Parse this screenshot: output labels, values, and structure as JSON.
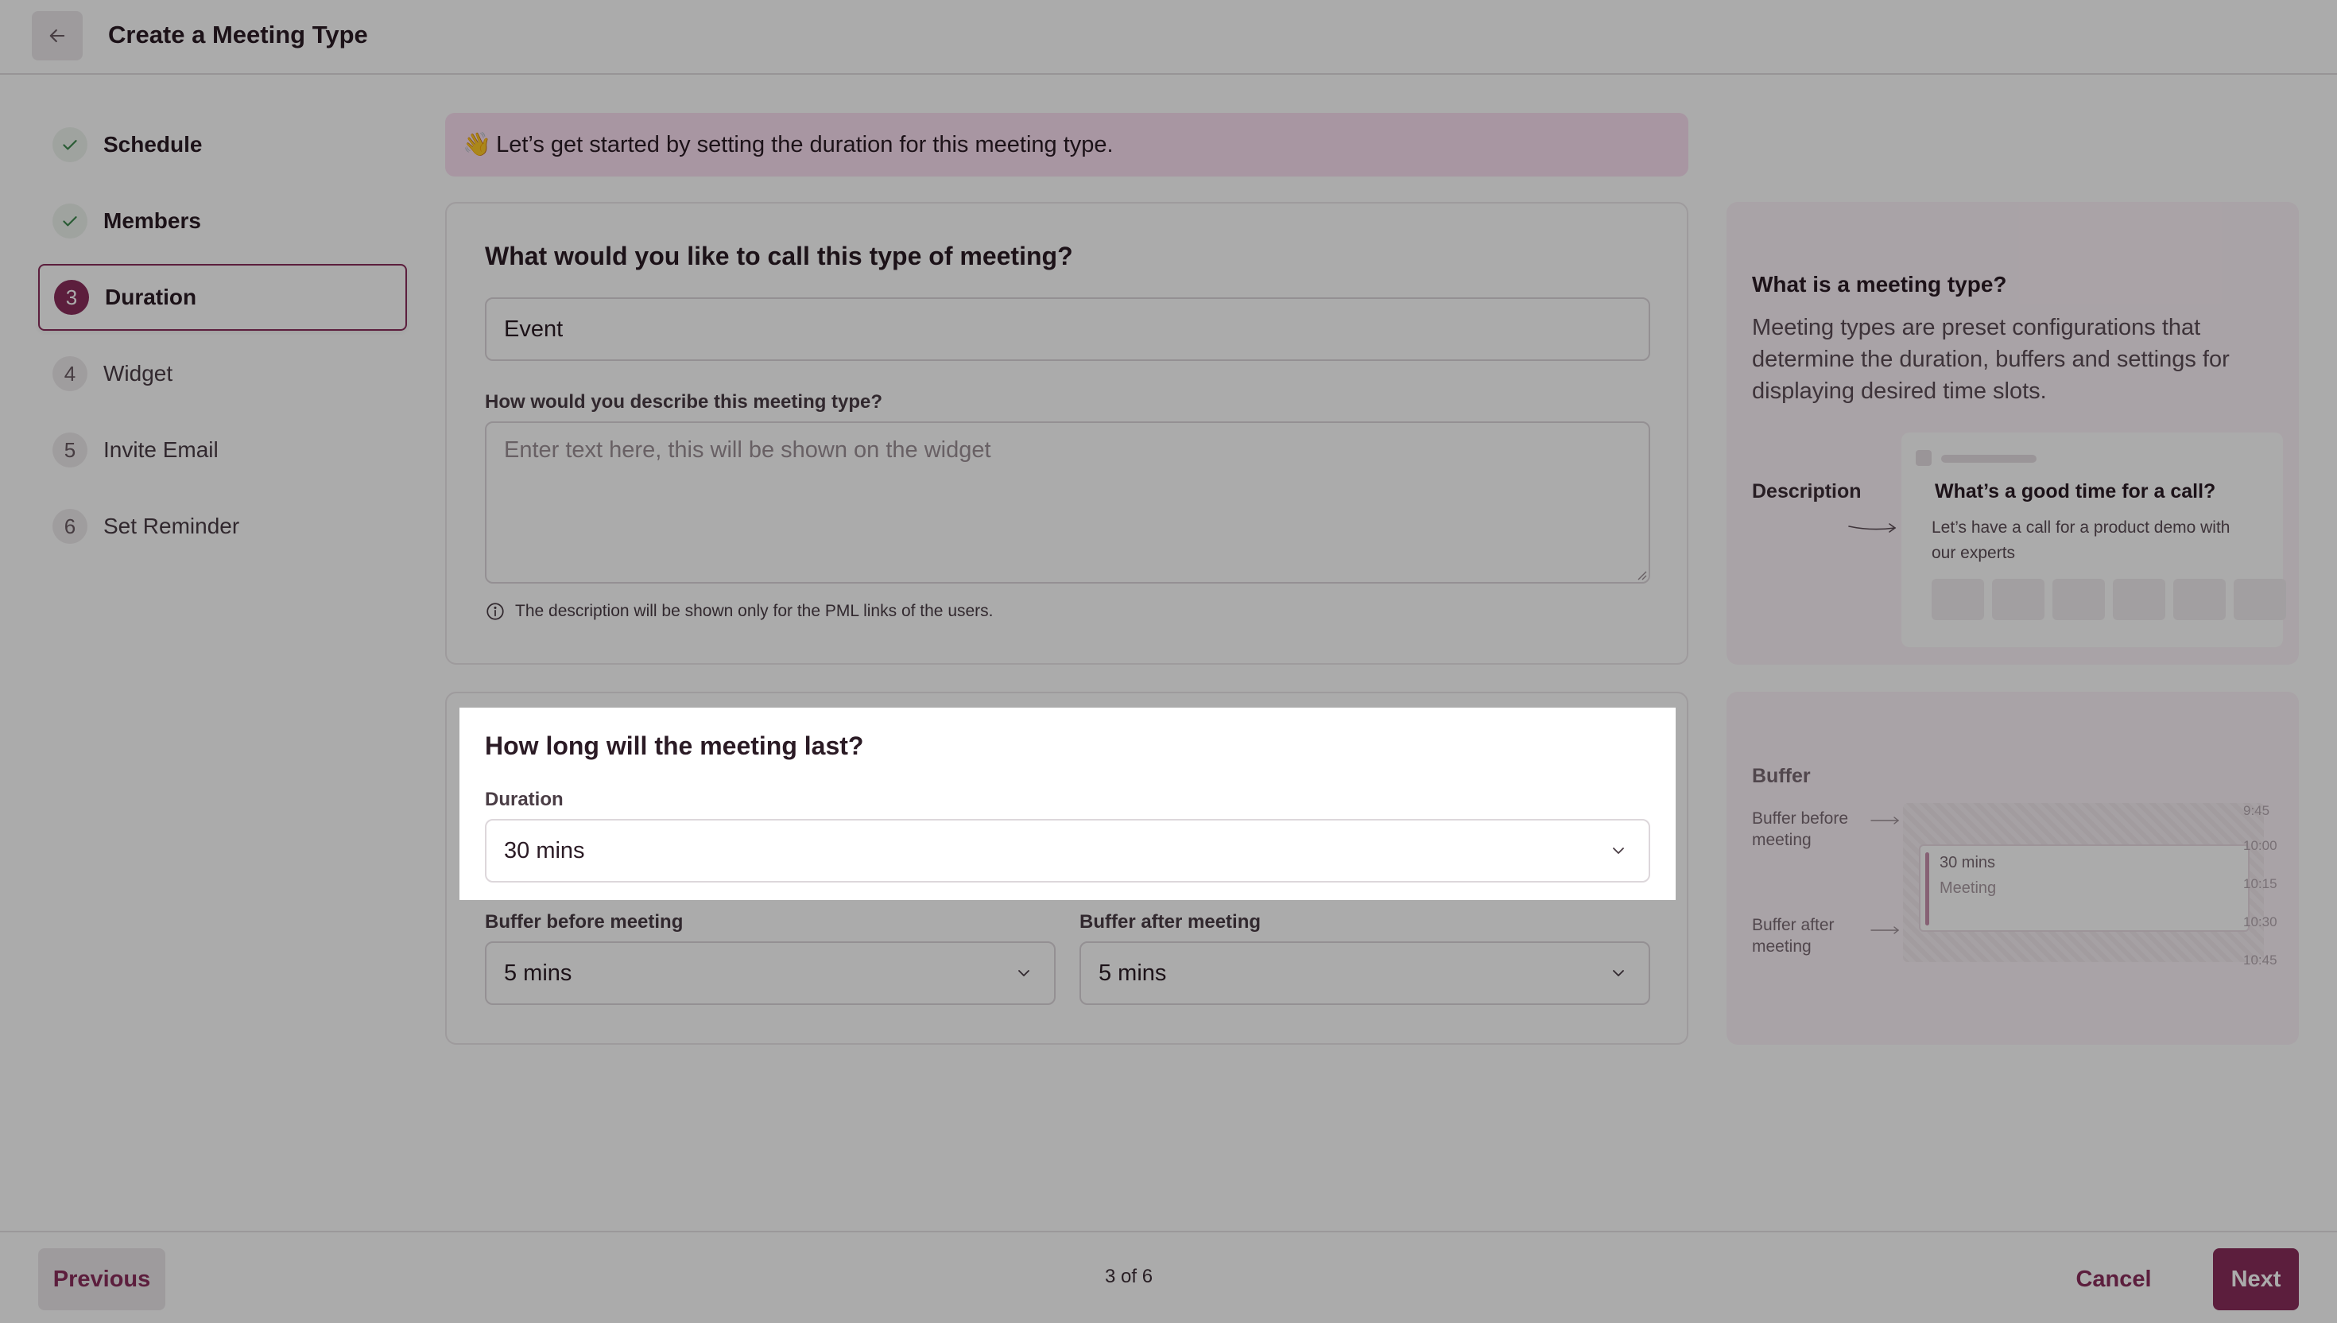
{
  "header": {
    "title": "Create a Meeting Type",
    "back_icon": "arrow-left-icon"
  },
  "steps": [
    {
      "number": "1",
      "label": "Schedule",
      "state": "done"
    },
    {
      "number": "2",
      "label": "Members",
      "state": "done"
    },
    {
      "number": "3",
      "label": "Duration",
      "state": "active"
    },
    {
      "number": "4",
      "label": "Widget",
      "state": "todo"
    },
    {
      "number": "5",
      "label": "Invite Email",
      "state": "todo"
    },
    {
      "number": "6",
      "label": "Set Reminder",
      "state": "todo"
    }
  ],
  "banner": {
    "emoji": "👋",
    "text": "Let’s get started by setting the duration for this meeting type."
  },
  "name_section": {
    "title": "What would you like to call this type of meeting?",
    "name_value": "Event",
    "description_label": "How would you describe this meeting type?",
    "description_placeholder": "Enter text here, this will be shown on the widget",
    "hint": "The description will be shown only for the PML links of the users."
  },
  "duration_section": {
    "title": "How long will the meeting last?",
    "duration_label": "Duration",
    "duration_value": "30 mins",
    "buffer_before_label": "Buffer before meeting",
    "buffer_before_value": "5 mins",
    "buffer_after_label": "Buffer after meeting",
    "buffer_after_value": "5 mins"
  },
  "help_meeting_type": {
    "title": "What is a meeting type?",
    "text": "Meeting types are preset configurations that determine the duration, buffers and settings for displaying desired time slots.",
    "description_label": "Description",
    "preview_title": "What’s a good time for a call?",
    "preview_subtitle": "Let’s have a call for a product demo with our experts"
  },
  "help_buffer": {
    "title": "Buffer",
    "before_label": "Buffer before meeting",
    "after_label": "Buffer after meeting",
    "meeting_time": "30 mins",
    "meeting_name": "Meeting",
    "ticks": [
      "9:45",
      "10:00",
      "10:15",
      "10:30",
      "10:45"
    ]
  },
  "footer": {
    "previous": "Previous",
    "page_count": "3 of 6",
    "cancel": "Cancel",
    "next": "Next"
  },
  "colors": {
    "accent": "#8a2e5c",
    "banner_bg": "#fbe0f2",
    "help_bg": "#fdf3f9"
  }
}
